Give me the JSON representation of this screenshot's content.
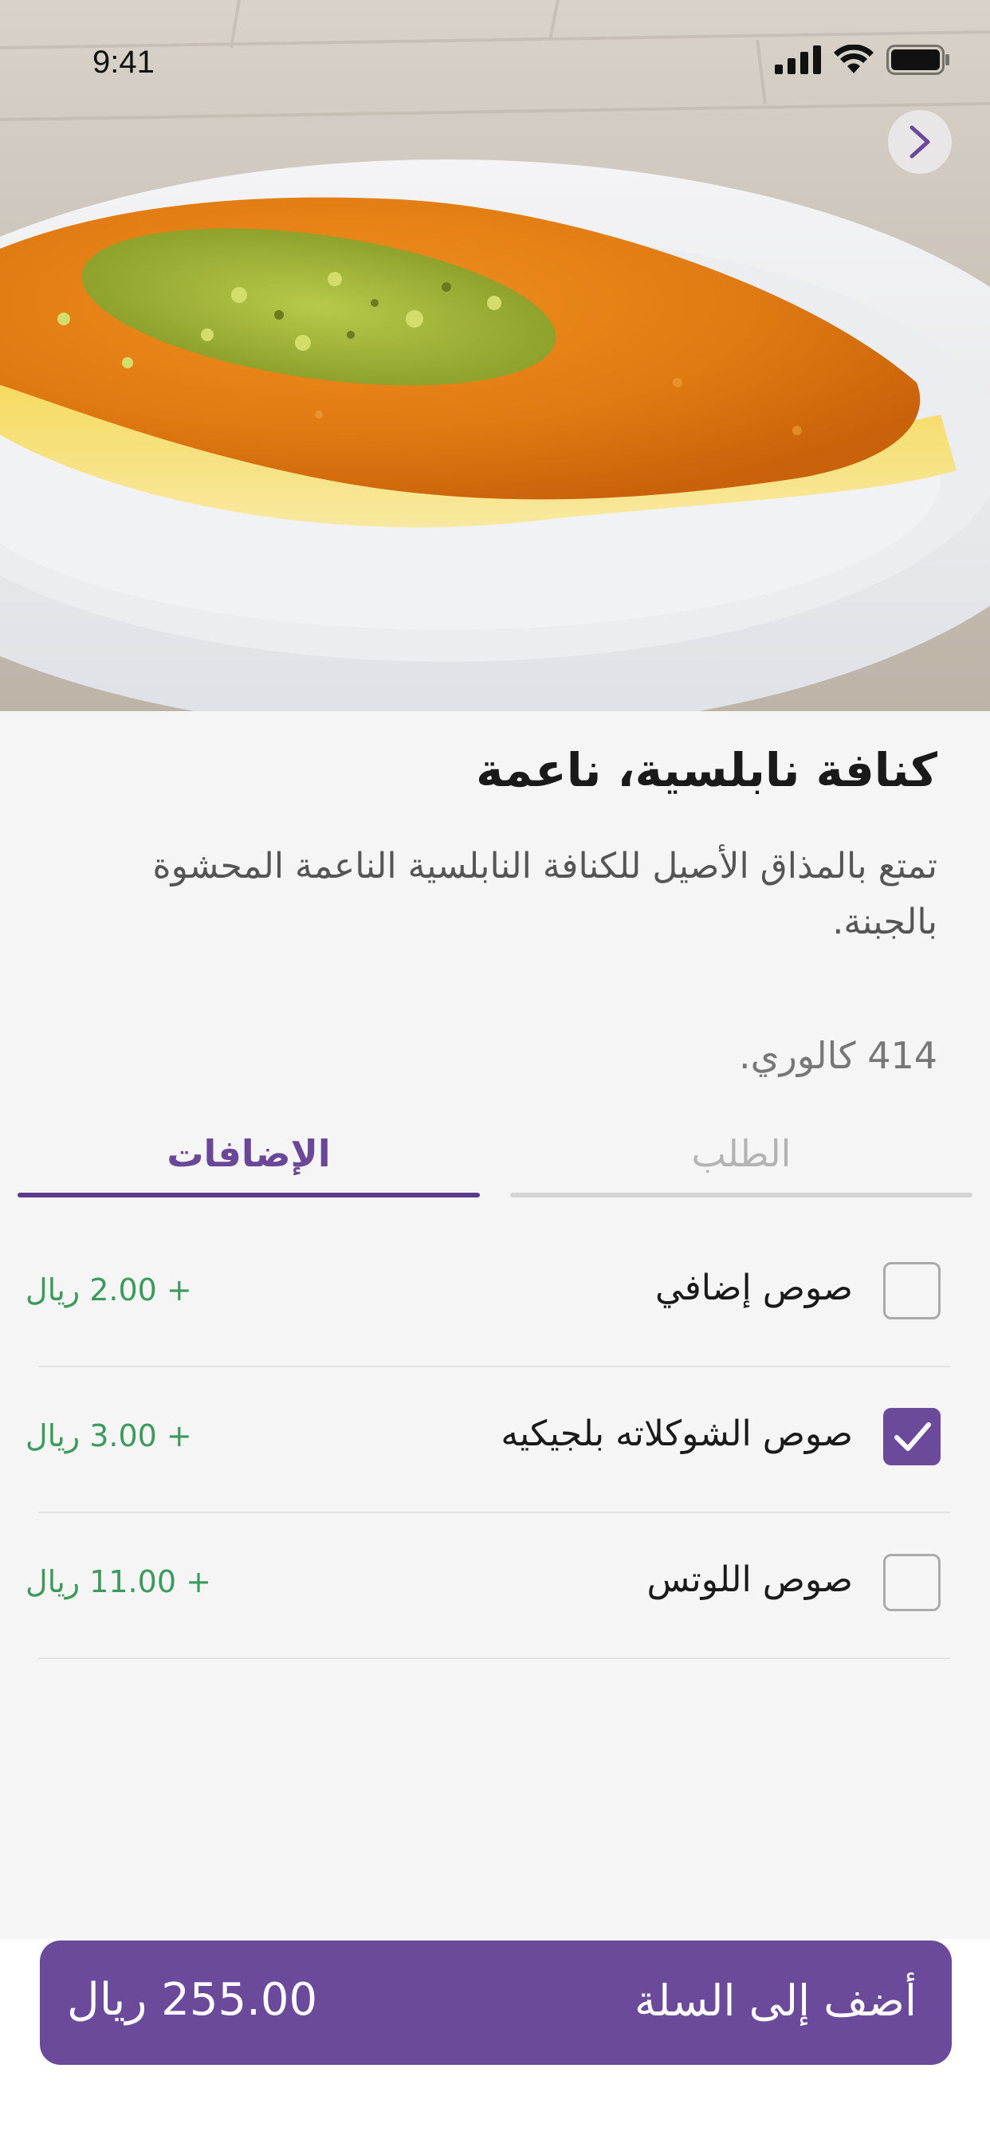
{
  "status_bar": {
    "time": "9:41"
  },
  "product": {
    "title": "كنافة نابلسية، ناعمة",
    "description": "تمتع بالمذاق الأصيل للكنافة النابلسية الناعمة المحشوة بالجبنة.",
    "calories": "414 كالوري."
  },
  "tabs": [
    {
      "label": "الطلب",
      "active": false
    },
    {
      "label": "الإضافات",
      "active": true
    }
  ],
  "addons": [
    {
      "name": "صوص إضافي",
      "price": "+ 2.00 ريال",
      "checked": false
    },
    {
      "name": "صوص الشوكلاته بلجيكيه",
      "price": "+ 3.00 ريال",
      "checked": true
    },
    {
      "name": "صوص اللوتس",
      "price": "+ 11.00 ريال",
      "checked": false
    }
  ],
  "cart": {
    "label": "أضف إلى السلة",
    "total": "255.00 ريال"
  },
  "colors": {
    "accent": "#6b4a9b",
    "price_green": "#3c9a5c",
    "tab_inactive": "#b3b3b3"
  },
  "icons": {
    "back": "chevron-right-icon",
    "checkbox_checked": "checkmark-icon"
  }
}
